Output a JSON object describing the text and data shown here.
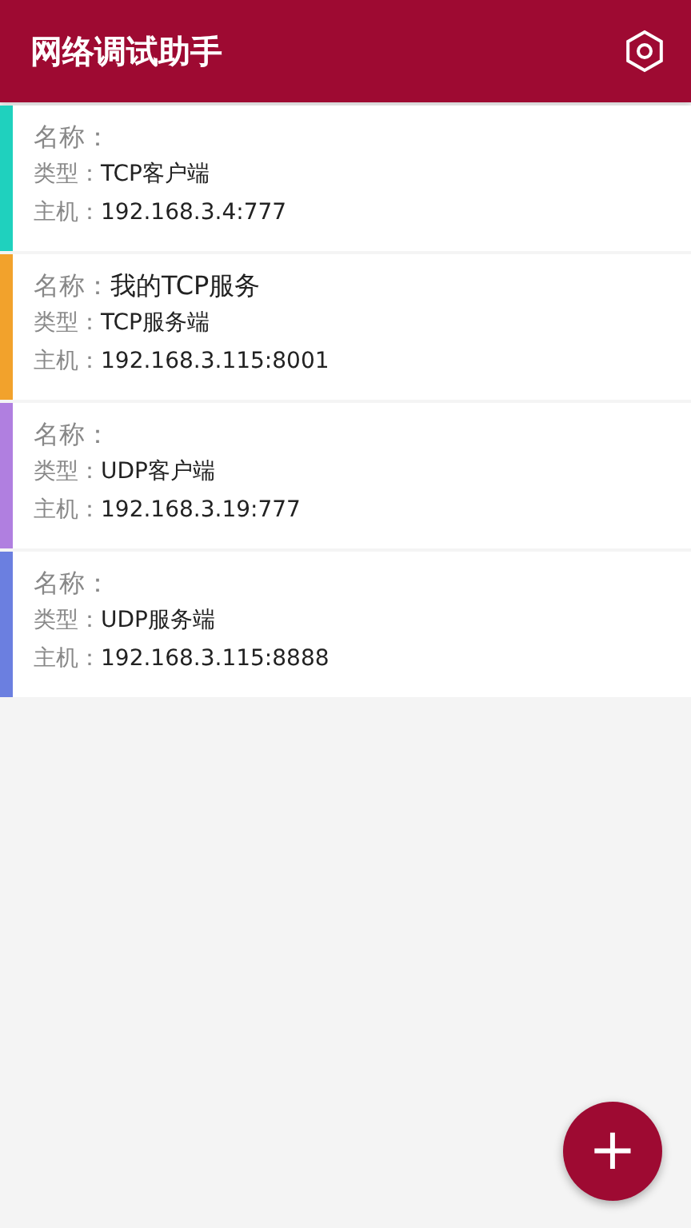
{
  "app_bar": {
    "title": "网络调试助手"
  },
  "connections": [
    {
      "color": "#1fd1be",
      "name_label": "名称：",
      "type_label": "类型：",
      "type": "TCP客户端",
      "host_label": "主机：",
      "host": "192.168.3.4:777"
    },
    {
      "color": "#f2a22c",
      "name_label": "名称：",
      "name": "我的TCP服务",
      "type_label": "类型：",
      "type": "TCP服务端",
      "host_label": "主机：",
      "host": "192.168.3.115:8001"
    },
    {
      "color": "#b07fe0",
      "name_label": "名称：",
      "type_label": "类型：",
      "type": "UDP客户端",
      "host_label": "主机：",
      "host": "192.168.3.19:777"
    },
    {
      "color": "#6b7fe0",
      "name_label": "名称：",
      "type_label": "类型：",
      "type": "UDP服务端",
      "host_label": "主机：",
      "host": "192.168.3.115:8888"
    }
  ],
  "fab": {
    "symbol": "+"
  }
}
